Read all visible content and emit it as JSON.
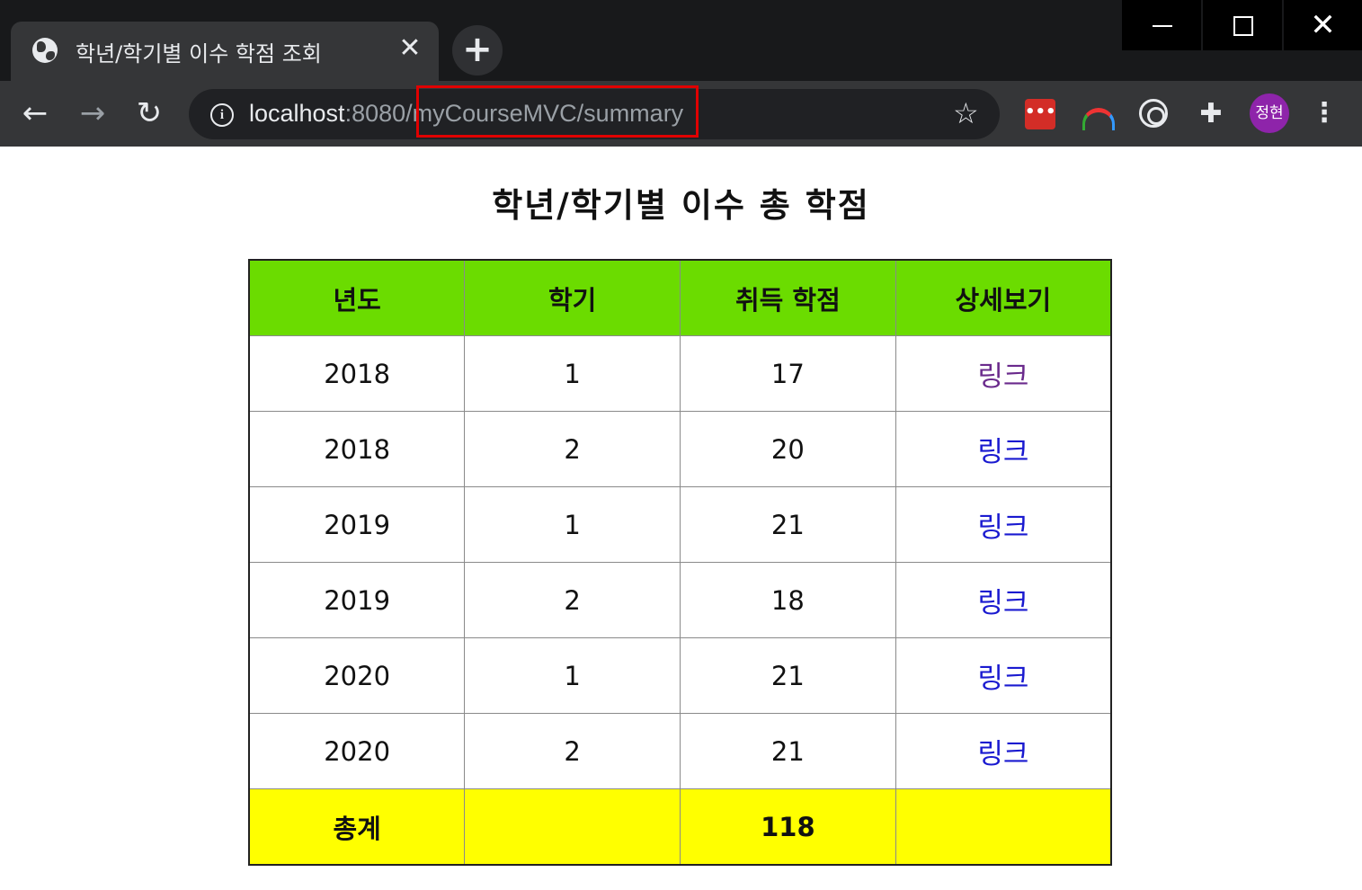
{
  "browser": {
    "tab_title": "학년/학기별 이수 학점 조회",
    "tab_close": "✕",
    "new_tab": "+",
    "url_host": "localhost",
    "url_rest": ":8080/myCourseMVC/summary",
    "profile_initials": "정현"
  },
  "page": {
    "title": "학년/학기별 이수 총 학점"
  },
  "table": {
    "headers": [
      "년도",
      "학기",
      "취득 학점",
      "상세보기"
    ],
    "rows": [
      {
        "year": "2018",
        "semester": "1",
        "credits": "17",
        "link": "링크"
      },
      {
        "year": "2018",
        "semester": "2",
        "credits": "20",
        "link": "링크"
      },
      {
        "year": "2019",
        "semester": "1",
        "credits": "21",
        "link": "링크"
      },
      {
        "year": "2019",
        "semester": "2",
        "credits": "18",
        "link": "링크"
      },
      {
        "year": "2020",
        "semester": "1",
        "credits": "21",
        "link": "링크"
      },
      {
        "year": "2020",
        "semester": "2",
        "credits": "21",
        "link": "링크"
      }
    ],
    "total_label": "총계",
    "total_credits": "118"
  },
  "colors": {
    "header_bg": "#6bdc00",
    "total_bg": "#ffff00",
    "link": "#1a1ad0",
    "link_visited": "#6a2a8c",
    "highlight_box": "#e00000"
  }
}
